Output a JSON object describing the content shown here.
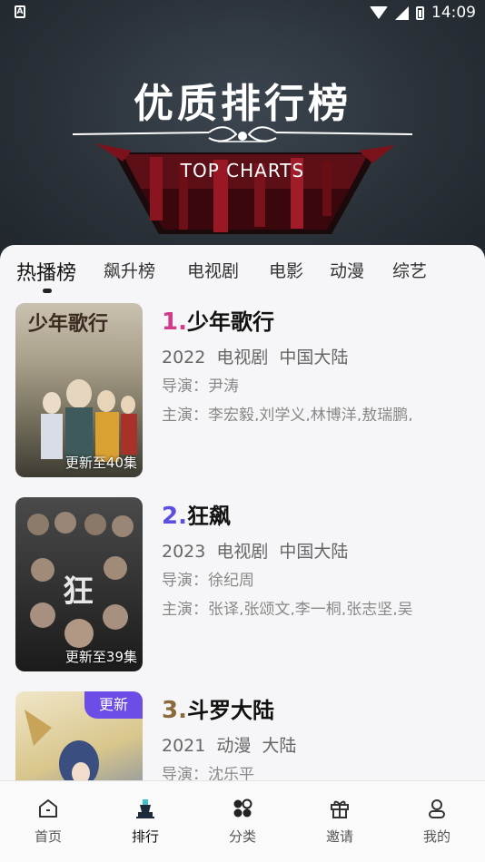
{
  "status_bar": {
    "time": "14:09",
    "indicator": "A"
  },
  "hero": {
    "title": "优质排行榜",
    "subtitle": "TOP CHARTS"
  },
  "tabs": [
    {
      "label": "热播榜",
      "active": true
    },
    {
      "label": "飙升榜",
      "active": false
    },
    {
      "label": "电视剧",
      "active": false
    },
    {
      "label": "电影",
      "active": false
    },
    {
      "label": "动漫",
      "active": false
    },
    {
      "label": "综艺",
      "active": false
    }
  ],
  "items": [
    {
      "rank": "1.",
      "rank_color": "#d23a8a",
      "title": "少年歌行",
      "meta": "2022  电视剧  中国大陆",
      "director": "导演：尹涛",
      "cast": "主演：李宏毅,刘学义,林博洋,敖瑞鹏,",
      "poster_label": "更新至40集",
      "badge": ""
    },
    {
      "rank": "2.",
      "rank_color": "#5a4fe0",
      "title": "狂飙",
      "meta": "2023  电视剧  中国大陆",
      "director": "导演：徐纪周",
      "cast": "主演：张译,张颂文,李一桐,张志坚,吴",
      "poster_label": "更新至39集",
      "badge": ""
    },
    {
      "rank": "3.",
      "rank_color": "#8a6a3a",
      "title": "斗罗大陆",
      "meta": "2021  动漫  大陆",
      "director": "导演：沈乐平",
      "cast": "",
      "poster_label": "",
      "badge": "更新"
    }
  ],
  "nav": [
    {
      "label": "首页",
      "icon": "home-icon"
    },
    {
      "label": "排行",
      "icon": "trophy-icon",
      "active": true
    },
    {
      "label": "分类",
      "icon": "category-icon"
    },
    {
      "label": "邀请",
      "icon": "gift-icon"
    },
    {
      "label": "我的",
      "icon": "user-icon"
    }
  ]
}
